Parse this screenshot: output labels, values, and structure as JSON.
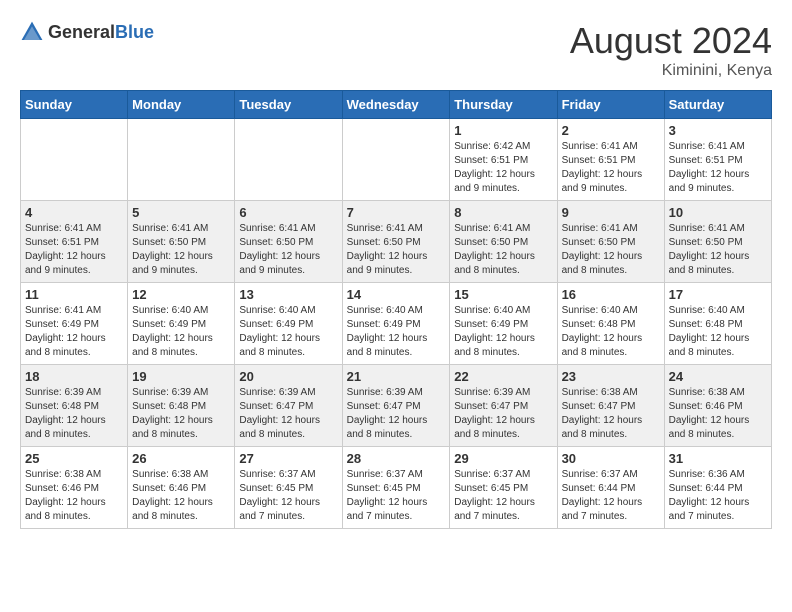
{
  "header": {
    "logo_general": "General",
    "logo_blue": "Blue",
    "month_year": "August 2024",
    "location": "Kiminini, Kenya"
  },
  "days_of_week": [
    "Sunday",
    "Monday",
    "Tuesday",
    "Wednesday",
    "Thursday",
    "Friday",
    "Saturday"
  ],
  "weeks": [
    [
      {
        "day": "",
        "info": ""
      },
      {
        "day": "",
        "info": ""
      },
      {
        "day": "",
        "info": ""
      },
      {
        "day": "",
        "info": ""
      },
      {
        "day": "1",
        "info": "Sunrise: 6:42 AM\nSunset: 6:51 PM\nDaylight: 12 hours and 9 minutes."
      },
      {
        "day": "2",
        "info": "Sunrise: 6:41 AM\nSunset: 6:51 PM\nDaylight: 12 hours and 9 minutes."
      },
      {
        "day": "3",
        "info": "Sunrise: 6:41 AM\nSunset: 6:51 PM\nDaylight: 12 hours and 9 minutes."
      }
    ],
    [
      {
        "day": "4",
        "info": "Sunrise: 6:41 AM\nSunset: 6:51 PM\nDaylight: 12 hours and 9 minutes."
      },
      {
        "day": "5",
        "info": "Sunrise: 6:41 AM\nSunset: 6:50 PM\nDaylight: 12 hours and 9 minutes."
      },
      {
        "day": "6",
        "info": "Sunrise: 6:41 AM\nSunset: 6:50 PM\nDaylight: 12 hours and 9 minutes."
      },
      {
        "day": "7",
        "info": "Sunrise: 6:41 AM\nSunset: 6:50 PM\nDaylight: 12 hours and 9 minutes."
      },
      {
        "day": "8",
        "info": "Sunrise: 6:41 AM\nSunset: 6:50 PM\nDaylight: 12 hours and 8 minutes."
      },
      {
        "day": "9",
        "info": "Sunrise: 6:41 AM\nSunset: 6:50 PM\nDaylight: 12 hours and 8 minutes."
      },
      {
        "day": "10",
        "info": "Sunrise: 6:41 AM\nSunset: 6:50 PM\nDaylight: 12 hours and 8 minutes."
      }
    ],
    [
      {
        "day": "11",
        "info": "Sunrise: 6:41 AM\nSunset: 6:49 PM\nDaylight: 12 hours and 8 minutes."
      },
      {
        "day": "12",
        "info": "Sunrise: 6:40 AM\nSunset: 6:49 PM\nDaylight: 12 hours and 8 minutes."
      },
      {
        "day": "13",
        "info": "Sunrise: 6:40 AM\nSunset: 6:49 PM\nDaylight: 12 hours and 8 minutes."
      },
      {
        "day": "14",
        "info": "Sunrise: 6:40 AM\nSunset: 6:49 PM\nDaylight: 12 hours and 8 minutes."
      },
      {
        "day": "15",
        "info": "Sunrise: 6:40 AM\nSunset: 6:49 PM\nDaylight: 12 hours and 8 minutes."
      },
      {
        "day": "16",
        "info": "Sunrise: 6:40 AM\nSunset: 6:48 PM\nDaylight: 12 hours and 8 minutes."
      },
      {
        "day": "17",
        "info": "Sunrise: 6:40 AM\nSunset: 6:48 PM\nDaylight: 12 hours and 8 minutes."
      }
    ],
    [
      {
        "day": "18",
        "info": "Sunrise: 6:39 AM\nSunset: 6:48 PM\nDaylight: 12 hours and 8 minutes."
      },
      {
        "day": "19",
        "info": "Sunrise: 6:39 AM\nSunset: 6:48 PM\nDaylight: 12 hours and 8 minutes."
      },
      {
        "day": "20",
        "info": "Sunrise: 6:39 AM\nSunset: 6:47 PM\nDaylight: 12 hours and 8 minutes."
      },
      {
        "day": "21",
        "info": "Sunrise: 6:39 AM\nSunset: 6:47 PM\nDaylight: 12 hours and 8 minutes."
      },
      {
        "day": "22",
        "info": "Sunrise: 6:39 AM\nSunset: 6:47 PM\nDaylight: 12 hours and 8 minutes."
      },
      {
        "day": "23",
        "info": "Sunrise: 6:38 AM\nSunset: 6:47 PM\nDaylight: 12 hours and 8 minutes."
      },
      {
        "day": "24",
        "info": "Sunrise: 6:38 AM\nSunset: 6:46 PM\nDaylight: 12 hours and 8 minutes."
      }
    ],
    [
      {
        "day": "25",
        "info": "Sunrise: 6:38 AM\nSunset: 6:46 PM\nDaylight: 12 hours and 8 minutes."
      },
      {
        "day": "26",
        "info": "Sunrise: 6:38 AM\nSunset: 6:46 PM\nDaylight: 12 hours and 8 minutes."
      },
      {
        "day": "27",
        "info": "Sunrise: 6:37 AM\nSunset: 6:45 PM\nDaylight: 12 hours and 7 minutes."
      },
      {
        "day": "28",
        "info": "Sunrise: 6:37 AM\nSunset: 6:45 PM\nDaylight: 12 hours and 7 minutes."
      },
      {
        "day": "29",
        "info": "Sunrise: 6:37 AM\nSunset: 6:45 PM\nDaylight: 12 hours and 7 minutes."
      },
      {
        "day": "30",
        "info": "Sunrise: 6:37 AM\nSunset: 6:44 PM\nDaylight: 12 hours and 7 minutes."
      },
      {
        "day": "31",
        "info": "Sunrise: 6:36 AM\nSunset: 6:44 PM\nDaylight: 12 hours and 7 minutes."
      }
    ]
  ]
}
